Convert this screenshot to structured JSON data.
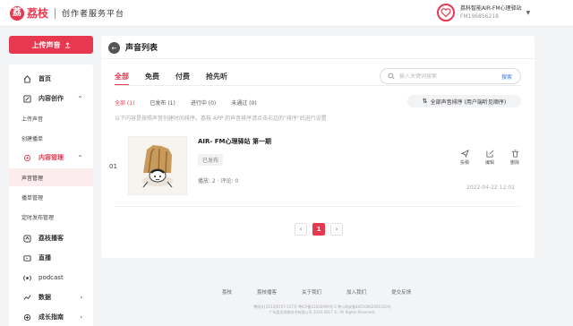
{
  "header": {
    "logo_mark": "荔",
    "logo_text": "荔枝",
    "platform_name": "创作者服务平台",
    "account_name": "荔科智能AIR-FM心理驿站",
    "account_id": "FM196856218"
  },
  "sidebar": {
    "upload_label": "上传声音",
    "items": [
      {
        "label": "首页",
        "icon": "home-icon"
      },
      {
        "label": "内容创作",
        "icon": "edit-icon"
      },
      {
        "label": "上传声音"
      },
      {
        "label": "创建播单"
      },
      {
        "label": "内容管理",
        "icon": "manage-icon"
      },
      {
        "label": "声音管理"
      },
      {
        "label": "播单管理"
      },
      {
        "label": "定时发布管理"
      },
      {
        "label": "荔枝播客",
        "icon": "podcast-icon"
      },
      {
        "label": "直播",
        "icon": "live-icon"
      },
      {
        "label": "podcast",
        "icon": "broadcast-icon"
      },
      {
        "label": "数据",
        "icon": "data-icon"
      },
      {
        "label": "成长指南",
        "icon": "growth-icon"
      }
    ]
  },
  "main": {
    "title": "声音列表",
    "tabs": [
      "全部",
      "免费",
      "付费",
      "抢先听"
    ],
    "search_placeholder": "输入关键词搜索",
    "search_button": "搜索",
    "filters": [
      "全部 (1)",
      "已发布 (1)",
      "进行中 (0)",
      "未通过 (0)"
    ],
    "sort_label": "全部声音排序 (用户端听见顺序)",
    "hint": "以下内容是按照声音创建时间排序。荔枝 APP 的声音排序请点击右边的\"排序\"后进行设置",
    "rows": [
      {
        "index": "01",
        "title": "AIR- FM心理驿站 第一期",
        "status": "已发布",
        "stats": "播放: 2 · 评论: 0",
        "actions": [
          "投稿",
          "编辑",
          "删除"
        ],
        "time": "2022-04-22 12:02"
      }
    ],
    "pagination": {
      "prev": "‹",
      "current": "1",
      "next": "›"
    }
  },
  "footer": {
    "links": [
      "荔枝",
      "荔枝播客",
      "关于我们",
      "加入我们",
      "提交反馈"
    ],
    "copyright_1": "粤网文[2013]0757-157号 粤ICP备12026999号-5 粤公网安备44010602001010号",
    "copyright_2": "广州荔支网络技术有限公司 2010-2017 ©, All Rights Reserved."
  },
  "colors": {
    "accent": "#e8384f",
    "link": "#3b7bea"
  }
}
